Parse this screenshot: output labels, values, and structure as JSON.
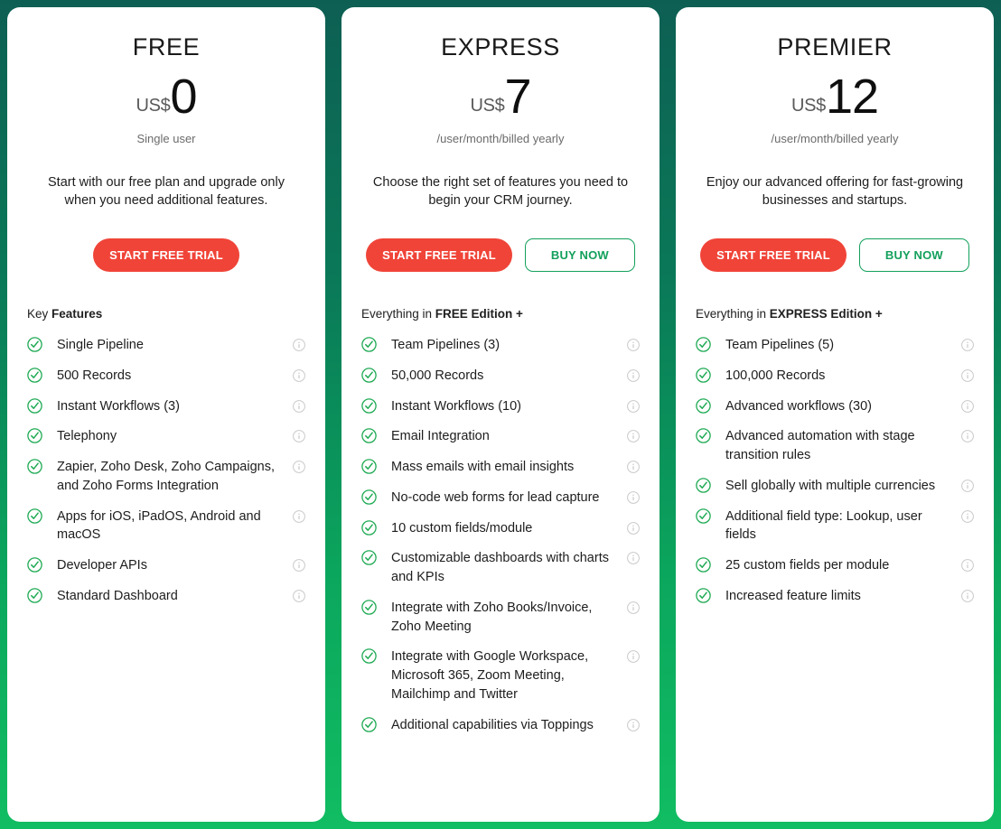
{
  "theme": {
    "background_gradient_top": "#0d5f53",
    "background_gradient_bottom": "#11bd62",
    "card_background": "#ffffff",
    "trial_button_color": "#f04438",
    "buy_button_color": "#13a05c",
    "check_icon_color": "#1faa54",
    "info_icon_color": "#c9c9c9"
  },
  "icons": {
    "check": "check-circle-icon",
    "info": "info-icon"
  },
  "plans": [
    {
      "id": "free",
      "name": "FREE",
      "currency": "US$",
      "amount": "0",
      "price_note": "Single user",
      "description": "Start with our free plan and upgrade only when you need additional features.",
      "buttons": [
        {
          "id": "start-free-trial",
          "label": "START FREE TRIAL",
          "style": "trial"
        }
      ],
      "features_header_prefix": "Key ",
      "features_header_strong": "Features",
      "features_header_suffix": "",
      "features": [
        "Single Pipeline",
        "500 Records",
        "Instant Workflows (3)",
        "Telephony",
        "Zapier, Zoho Desk, Zoho Campaigns, and Zoho Forms Integration",
        "Apps for iOS, iPadOS, Android and macOS",
        "Developer APIs",
        "Standard Dashboard"
      ]
    },
    {
      "id": "express",
      "name": "EXPRESS",
      "currency": "US$",
      "amount": "7",
      "price_note": "/user/month/billed yearly",
      "description": "Choose the right set of features you need to begin your CRM journey.",
      "buttons": [
        {
          "id": "start-free-trial",
          "label": "START FREE TRIAL",
          "style": "trial"
        },
        {
          "id": "buy-now",
          "label": "BUY NOW",
          "style": "buy"
        }
      ],
      "features_header_prefix": "Everything in ",
      "features_header_strong": "FREE Edition +",
      "features_header_suffix": "",
      "features": [
        "Team Pipelines (3)",
        "50,000 Records",
        "Instant Workflows (10)",
        "Email Integration",
        "Mass emails with email insights",
        "No-code web forms for lead capture",
        "10 custom fields/module",
        "Customizable dashboards with charts and KPIs",
        "Integrate with Zoho Books/Invoice, Zoho Meeting",
        "Integrate with Google Workspace, Microsoft 365, Zoom Meeting, Mailchimp and Twitter",
        "Additional capabilities via Toppings"
      ]
    },
    {
      "id": "premier",
      "name": "PREMIER",
      "currency": "US$",
      "amount": "12",
      "price_note": "/user/month/billed yearly",
      "description": "Enjoy our advanced offering for fast-growing businesses and startups.",
      "buttons": [
        {
          "id": "start-free-trial",
          "label": "START FREE TRIAL",
          "style": "trial"
        },
        {
          "id": "buy-now",
          "label": "BUY NOW",
          "style": "buy"
        }
      ],
      "features_header_prefix": "Everything in ",
      "features_header_strong": "EXPRESS Edition +",
      "features_header_suffix": "",
      "features": [
        "Team Pipelines (5)",
        "100,000 Records",
        "Advanced workflows (30)",
        "Advanced automation with stage transition rules",
        "Sell globally with multiple currencies",
        "Additional field type: Lookup, user fields",
        "25 custom fields per module",
        "Increased feature limits"
      ]
    }
  ]
}
